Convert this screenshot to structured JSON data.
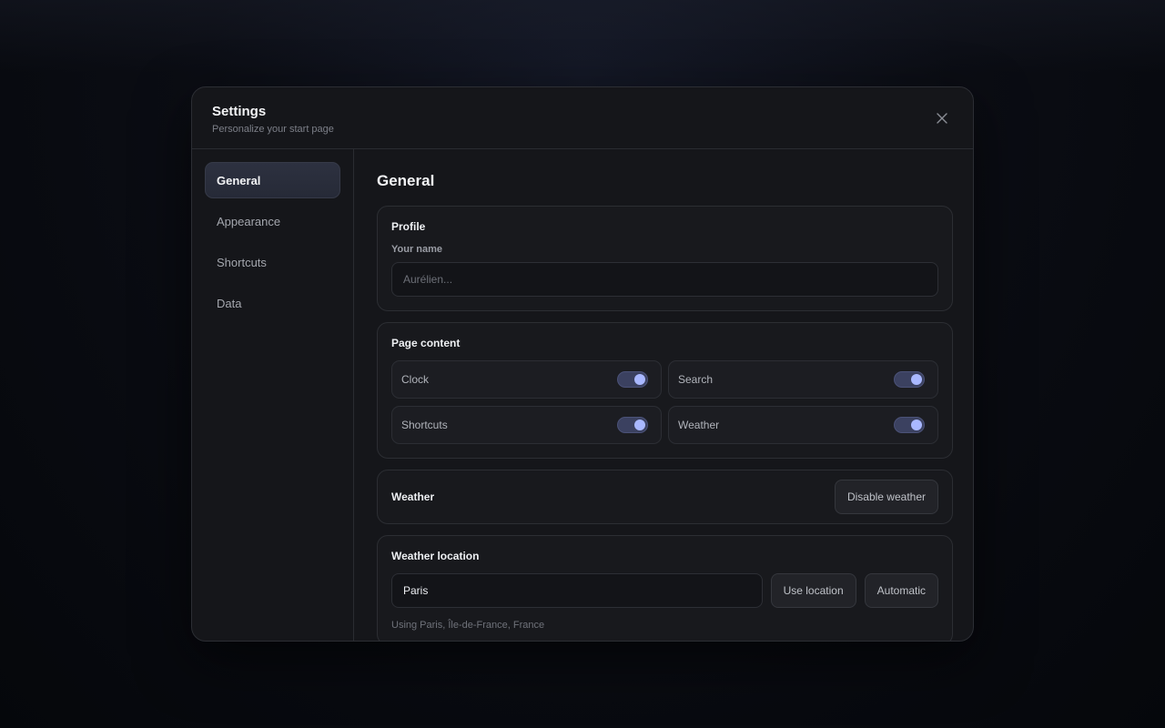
{
  "modal": {
    "title": "Settings",
    "subtitle": "Personalize your start page",
    "close_icon": "close-icon"
  },
  "sidebar": {
    "items": [
      {
        "label": "General",
        "active": true
      },
      {
        "label": "Appearance",
        "active": false
      },
      {
        "label": "Shortcuts",
        "active": false
      },
      {
        "label": "Data",
        "active": false
      }
    ]
  },
  "content": {
    "section_title": "General",
    "profile": {
      "title": "Profile",
      "name_label": "Your name",
      "name_value": "",
      "name_placeholder": "Aurélien..."
    },
    "page_content": {
      "title": "Page content",
      "toggles": [
        {
          "label": "Clock",
          "on": true
        },
        {
          "label": "Search",
          "on": true
        },
        {
          "label": "Shortcuts",
          "on": true
        },
        {
          "label": "Weather",
          "on": true
        }
      ]
    },
    "weather": {
      "title": "Weather",
      "disable_label": "Disable weather"
    },
    "weather_location": {
      "title": "Weather location",
      "location_value": "Paris",
      "use_location_label": "Use location",
      "automatic_label": "Automatic",
      "hint": "Using Paris, Île-de-France, France"
    }
  },
  "colors": {
    "accent": "#a9b8ff",
    "switch_track": "#3b4160",
    "modal_bg": "#15161a"
  }
}
